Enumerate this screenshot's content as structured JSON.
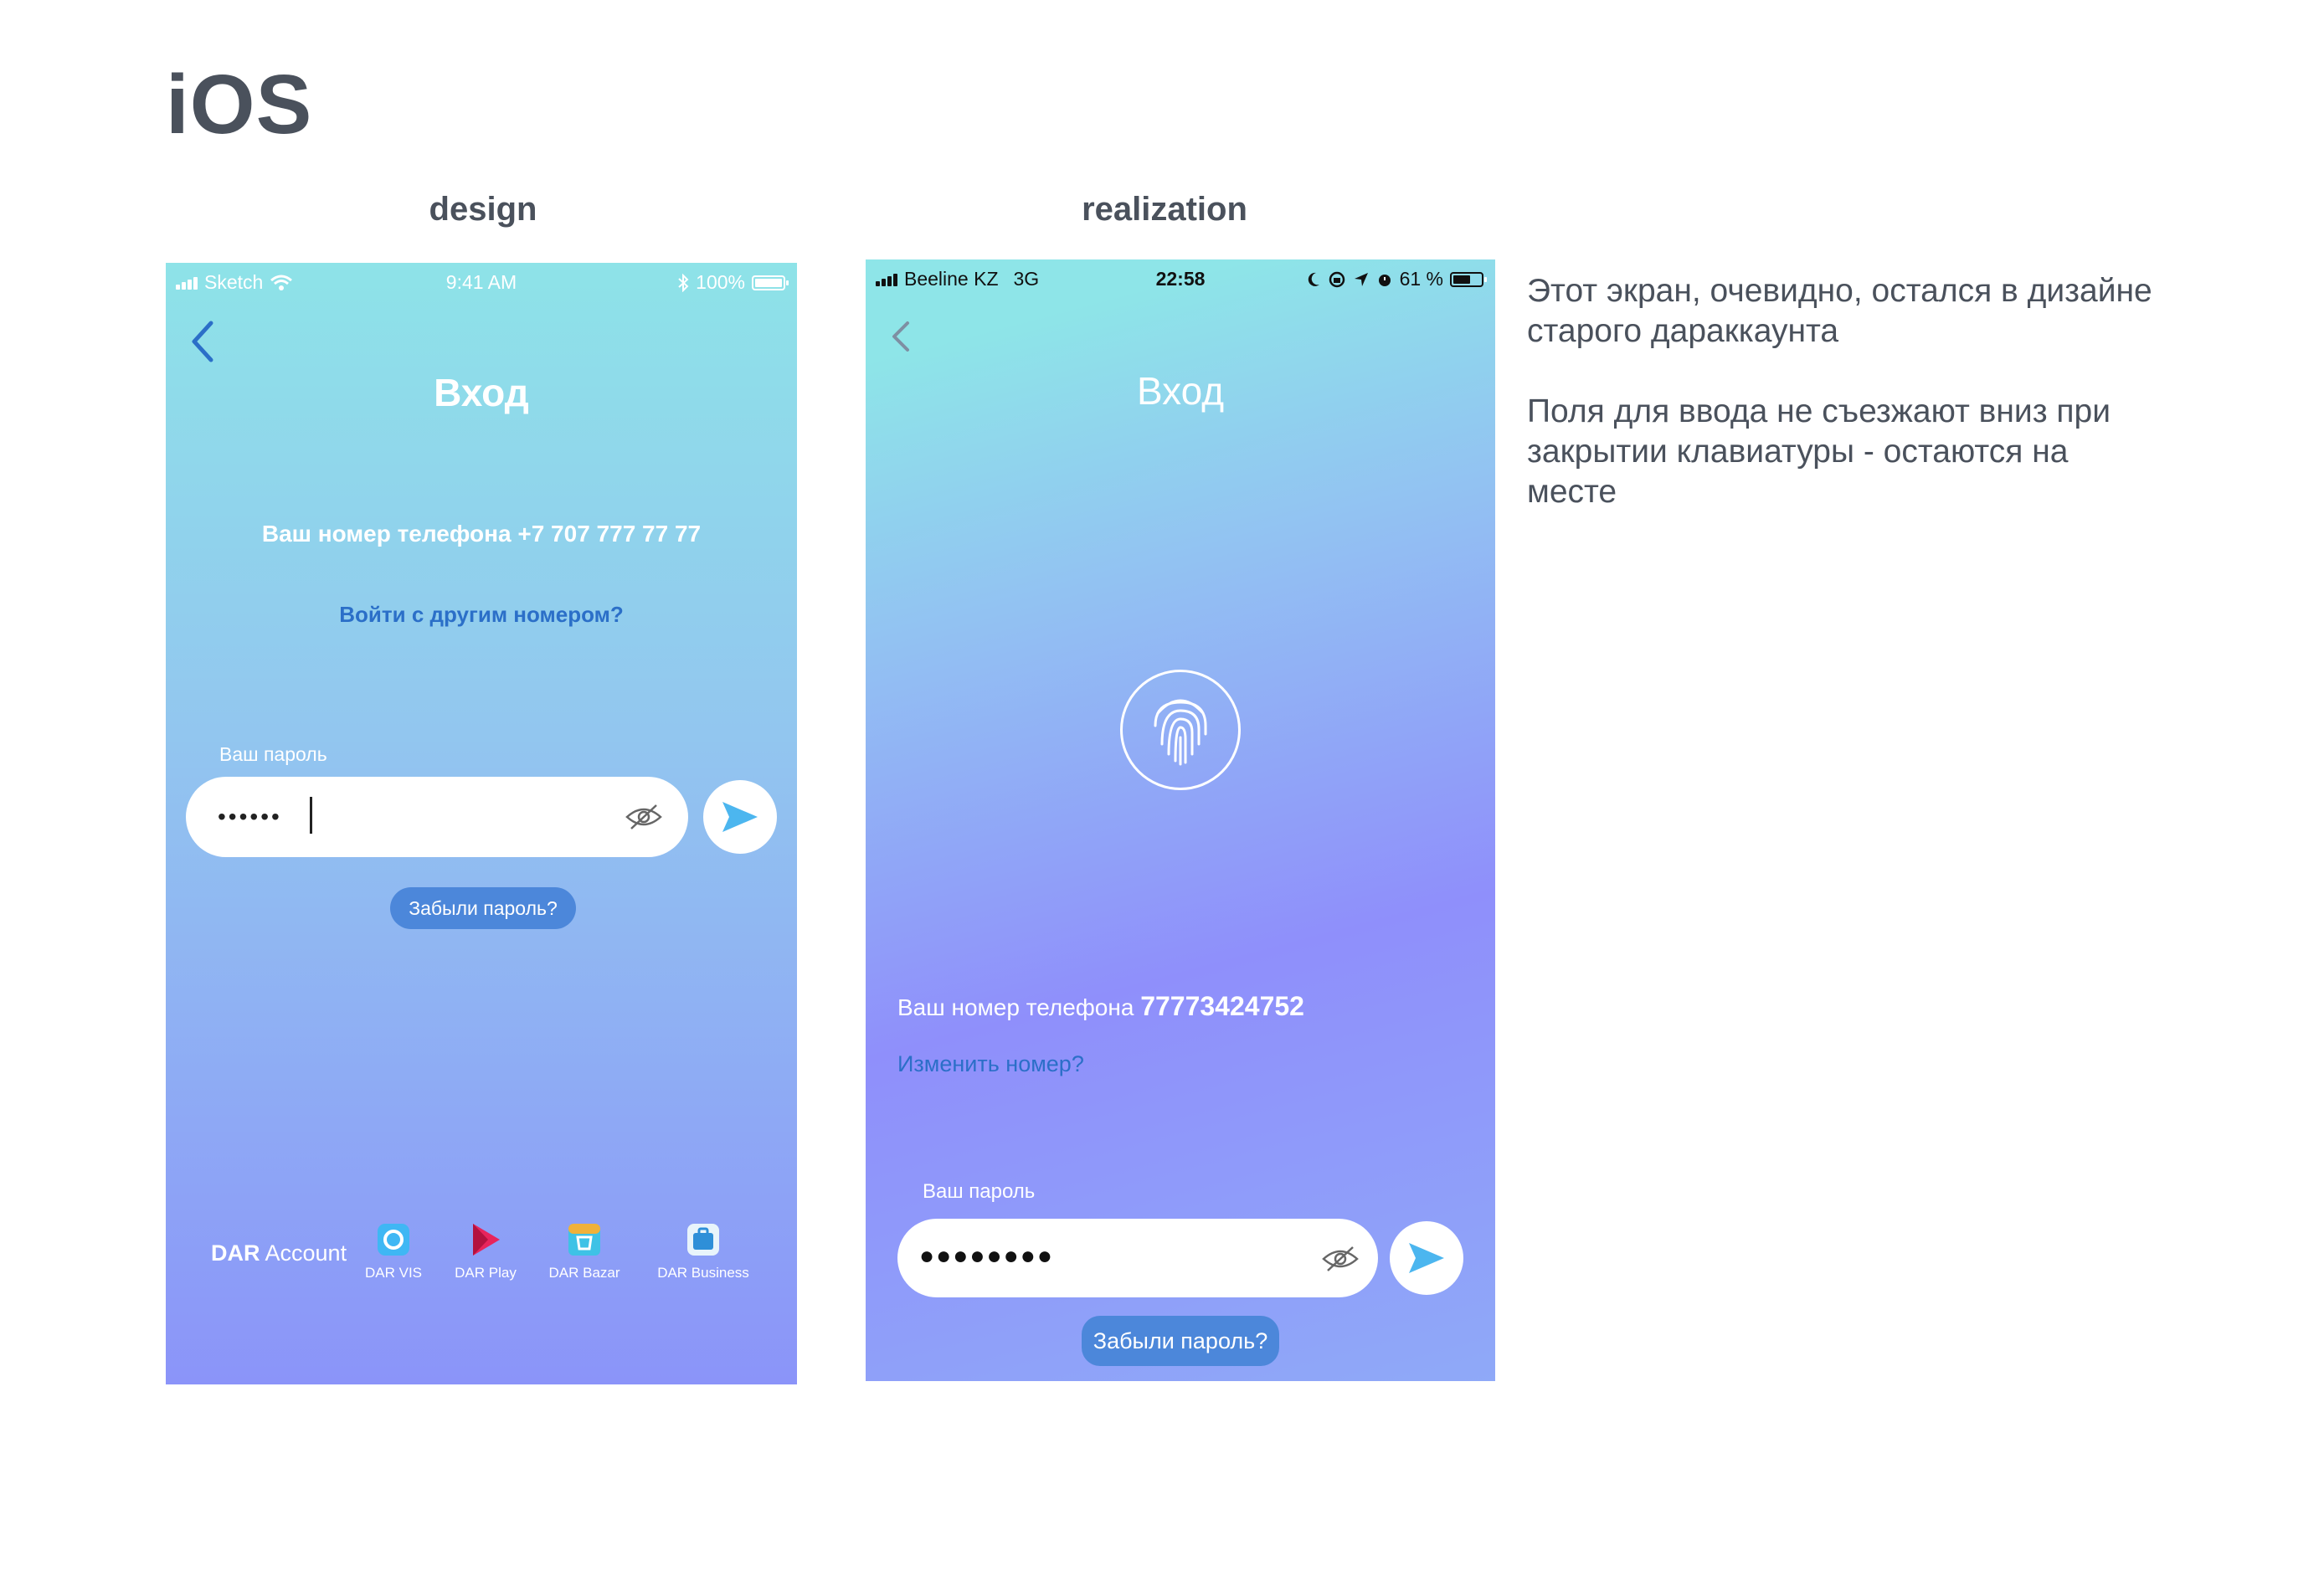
{
  "page": {
    "title": "iOS"
  },
  "columns": {
    "design": "design",
    "realization": "realization"
  },
  "design_screen": {
    "status_bar": {
      "carrier": "Sketch",
      "time": "9:41 AM",
      "battery": "100%",
      "battery_level": 1.0
    },
    "title": "Вход",
    "phone_label": "Ваш номер телефона +7 707 777 77 77",
    "other_number_link": "Войти с другим номером?",
    "password_label": "Ваш пароль",
    "password_value": "••••••",
    "forgot_button": "Забыли пароль?",
    "footer": {
      "brand_bold": "DAR",
      "brand_light": "Account",
      "apps": [
        {
          "name": "DAR VIS",
          "icon": "dar-vis-icon",
          "color": "#3fb7f4"
        },
        {
          "name": "DAR Play",
          "icon": "dar-play-icon",
          "color": "#e8245c"
        },
        {
          "name": "DAR Bazar",
          "icon": "dar-bazar-icon",
          "color": "#3ec2e6"
        },
        {
          "name": "DAR Business",
          "icon": "dar-business-icon",
          "color": "#2e8fd8"
        }
      ]
    }
  },
  "real_screen": {
    "status_bar": {
      "carrier": "Beeline KZ",
      "network": "3G",
      "time": "22:58",
      "battery": "61 %",
      "battery_level": 0.61
    },
    "title": "Вход",
    "phone_label": "Ваш номер телефона",
    "phone_number": "77773424752",
    "change_number_link": "Изменить номер?",
    "password_label": "Ваш пароль",
    "password_value": "●●●●●●●●",
    "forgot_button": "Забыли пароль?"
  },
  "notes": {
    "line1": "Этот экран, очевидно, остался в дизайне старого дараккаунта",
    "line2": "Поля для ввода не съезжают вниз при закрытии клавиатуры - остаются на месте"
  },
  "colors": {
    "accent_link": "#2b6fc8",
    "pill": "#4c87da",
    "send_arrow": "#4cb6ef",
    "text_dark": "#4a515c"
  }
}
